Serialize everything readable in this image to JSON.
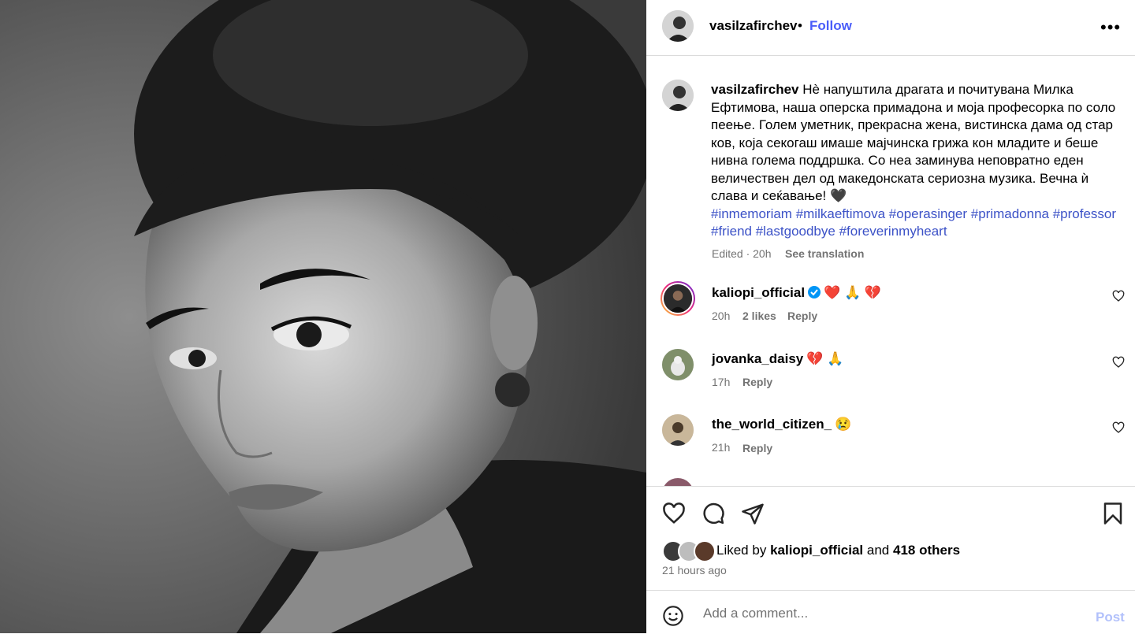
{
  "post": {
    "author": "vasilzafirchev",
    "dot": "•",
    "follow_label": "Follow",
    "more_label": "•••",
    "caption": {
      "author": "vasilzafirchev",
      "text": "Нè напуштила драгата и почитувана Милка Ефтимова, наша оперска примадона и моја професорка по соло пеење. Голем уметник, прекрасна жена, вистинска дама од стар ков, која секогаш имаше мајчинска грижа кон младите и беше нивна голема поддршка. Со неа заминува неповратно еден величествен дел од македонската сериозна музика. Вечна ѝ слава и сеќавање! 🖤",
      "hashtags": "#inmemoriam #milkaeftimova #operasinger #primadonna #professor #friend #lastgoodbye #foreverinmyheart",
      "edited": "Edited · 20h",
      "see_translation": "See translation"
    }
  },
  "comments": [
    {
      "user": "kaliopi_official",
      "verified": true,
      "text": "❤️ 🙏 💔",
      "time": "20h",
      "likes": "2 likes",
      "reply": "Reply"
    },
    {
      "user": "jovanka_daisy",
      "verified": false,
      "text": "💔 🙏",
      "time": "17h",
      "likes": "",
      "reply": "Reply"
    },
    {
      "user": "the_world_citizen_",
      "verified": false,
      "text": "😢",
      "time": "21h",
      "likes": "",
      "reply": "Reply"
    }
  ],
  "actions": {
    "liked_by_prefix": "Liked by",
    "liked_by_user": "kaliopi_official",
    "and": "and",
    "others": "418 others",
    "time_ago": "21 hours ago",
    "icons": [
      "heart-icon",
      "comment-icon",
      "share-icon",
      "bookmark-icon"
    ]
  },
  "add_comment": {
    "placeholder": "Add a comment...",
    "post_label": "Post"
  },
  "colors": {
    "link": "#4a5df9",
    "hashtag": "#3c52c7",
    "muted": "#737373",
    "post_disabled": "#b2c1fb",
    "verified": "#0095f6"
  }
}
